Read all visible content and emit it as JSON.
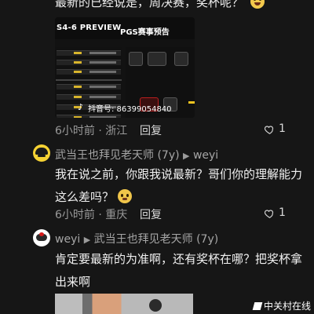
{
  "top_comment": {
    "text": "最新的已经说是，周决赛，奖杯呢？"
  },
  "preview_card": {
    "title": "S4-6 PREVIEW",
    "subtitle": "PGS赛事预告",
    "watermark": "抖音号: 86399054840"
  },
  "comments": [
    {
      "time": "6小时前",
      "location": "浙江",
      "reply": "回复",
      "likes": "1"
    },
    {
      "author": "武当王也拜见老天师 (7y)",
      "reply_to": "weyi",
      "text_line1": "我在说之前，你跟我说最新？哥们你的理解能力",
      "text_line2": "这么差吗？",
      "time": "6小时前",
      "location": "重庆",
      "reply": "回复",
      "likes": "1"
    },
    {
      "author": "weyi",
      "reply_to": "武当王也拜见老天师 (7y)",
      "text_line1": "肯定要最新的为准啊，还有奖杯在哪？把奖杯拿",
      "text_line2": "出来啊"
    }
  ],
  "brand": {
    "label": "中关村在线"
  }
}
